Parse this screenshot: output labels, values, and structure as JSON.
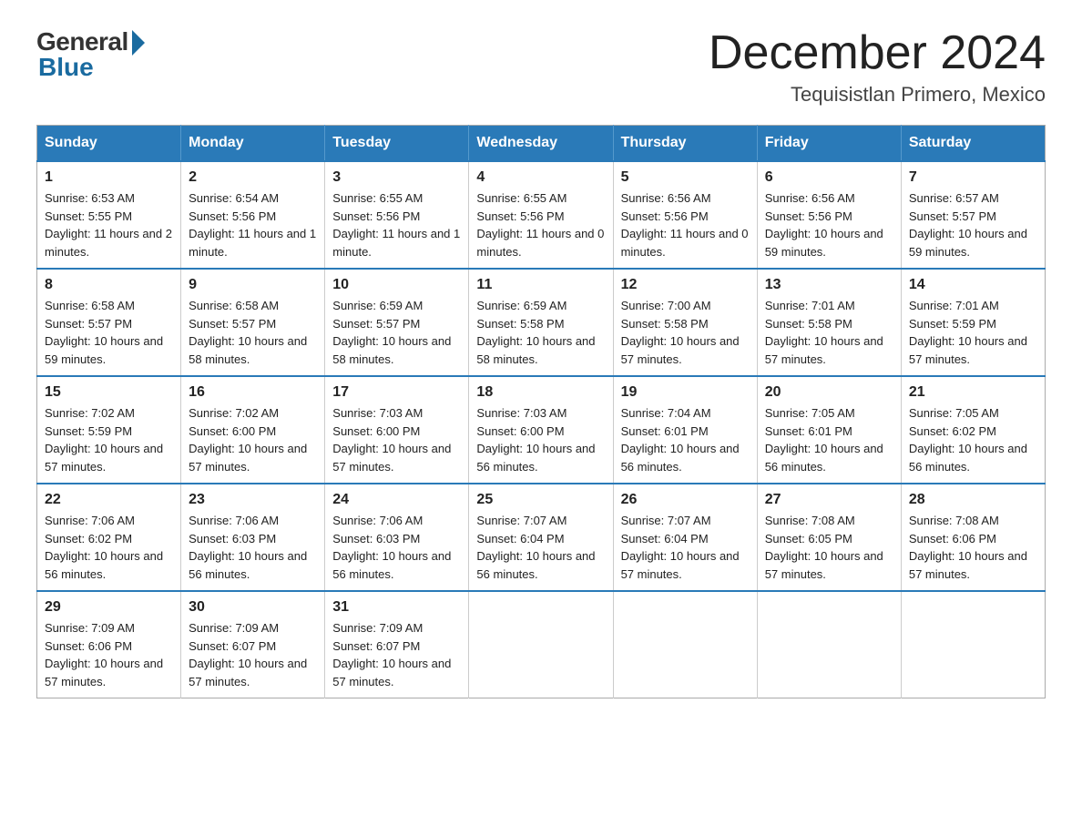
{
  "header": {
    "logo_general": "General",
    "logo_blue": "Blue",
    "month_title": "December 2024",
    "location": "Tequisistlan Primero, Mexico"
  },
  "days_of_week": [
    "Sunday",
    "Monday",
    "Tuesday",
    "Wednesday",
    "Thursday",
    "Friday",
    "Saturday"
  ],
  "weeks": [
    [
      {
        "day": "1",
        "sunrise": "6:53 AM",
        "sunset": "5:55 PM",
        "daylight": "11 hours and 2 minutes."
      },
      {
        "day": "2",
        "sunrise": "6:54 AM",
        "sunset": "5:56 PM",
        "daylight": "11 hours and 1 minute."
      },
      {
        "day": "3",
        "sunrise": "6:55 AM",
        "sunset": "5:56 PM",
        "daylight": "11 hours and 1 minute."
      },
      {
        "day": "4",
        "sunrise": "6:55 AM",
        "sunset": "5:56 PM",
        "daylight": "11 hours and 0 minutes."
      },
      {
        "day": "5",
        "sunrise": "6:56 AM",
        "sunset": "5:56 PM",
        "daylight": "11 hours and 0 minutes."
      },
      {
        "day": "6",
        "sunrise": "6:56 AM",
        "sunset": "5:56 PM",
        "daylight": "10 hours and 59 minutes."
      },
      {
        "day": "7",
        "sunrise": "6:57 AM",
        "sunset": "5:57 PM",
        "daylight": "10 hours and 59 minutes."
      }
    ],
    [
      {
        "day": "8",
        "sunrise": "6:58 AM",
        "sunset": "5:57 PM",
        "daylight": "10 hours and 59 minutes."
      },
      {
        "day": "9",
        "sunrise": "6:58 AM",
        "sunset": "5:57 PM",
        "daylight": "10 hours and 58 minutes."
      },
      {
        "day": "10",
        "sunrise": "6:59 AM",
        "sunset": "5:57 PM",
        "daylight": "10 hours and 58 minutes."
      },
      {
        "day": "11",
        "sunrise": "6:59 AM",
        "sunset": "5:58 PM",
        "daylight": "10 hours and 58 minutes."
      },
      {
        "day": "12",
        "sunrise": "7:00 AM",
        "sunset": "5:58 PM",
        "daylight": "10 hours and 57 minutes."
      },
      {
        "day": "13",
        "sunrise": "7:01 AM",
        "sunset": "5:58 PM",
        "daylight": "10 hours and 57 minutes."
      },
      {
        "day": "14",
        "sunrise": "7:01 AM",
        "sunset": "5:59 PM",
        "daylight": "10 hours and 57 minutes."
      }
    ],
    [
      {
        "day": "15",
        "sunrise": "7:02 AM",
        "sunset": "5:59 PM",
        "daylight": "10 hours and 57 minutes."
      },
      {
        "day": "16",
        "sunrise": "7:02 AM",
        "sunset": "6:00 PM",
        "daylight": "10 hours and 57 minutes."
      },
      {
        "day": "17",
        "sunrise": "7:03 AM",
        "sunset": "6:00 PM",
        "daylight": "10 hours and 57 minutes."
      },
      {
        "day": "18",
        "sunrise": "7:03 AM",
        "sunset": "6:00 PM",
        "daylight": "10 hours and 56 minutes."
      },
      {
        "day": "19",
        "sunrise": "7:04 AM",
        "sunset": "6:01 PM",
        "daylight": "10 hours and 56 minutes."
      },
      {
        "day": "20",
        "sunrise": "7:05 AM",
        "sunset": "6:01 PM",
        "daylight": "10 hours and 56 minutes."
      },
      {
        "day": "21",
        "sunrise": "7:05 AM",
        "sunset": "6:02 PM",
        "daylight": "10 hours and 56 minutes."
      }
    ],
    [
      {
        "day": "22",
        "sunrise": "7:06 AM",
        "sunset": "6:02 PM",
        "daylight": "10 hours and 56 minutes."
      },
      {
        "day": "23",
        "sunrise": "7:06 AM",
        "sunset": "6:03 PM",
        "daylight": "10 hours and 56 minutes."
      },
      {
        "day": "24",
        "sunrise": "7:06 AM",
        "sunset": "6:03 PM",
        "daylight": "10 hours and 56 minutes."
      },
      {
        "day": "25",
        "sunrise": "7:07 AM",
        "sunset": "6:04 PM",
        "daylight": "10 hours and 56 minutes."
      },
      {
        "day": "26",
        "sunrise": "7:07 AM",
        "sunset": "6:04 PM",
        "daylight": "10 hours and 57 minutes."
      },
      {
        "day": "27",
        "sunrise": "7:08 AM",
        "sunset": "6:05 PM",
        "daylight": "10 hours and 57 minutes."
      },
      {
        "day": "28",
        "sunrise": "7:08 AM",
        "sunset": "6:06 PM",
        "daylight": "10 hours and 57 minutes."
      }
    ],
    [
      {
        "day": "29",
        "sunrise": "7:09 AM",
        "sunset": "6:06 PM",
        "daylight": "10 hours and 57 minutes."
      },
      {
        "day": "30",
        "sunrise": "7:09 AM",
        "sunset": "6:07 PM",
        "daylight": "10 hours and 57 minutes."
      },
      {
        "day": "31",
        "sunrise": "7:09 AM",
        "sunset": "6:07 PM",
        "daylight": "10 hours and 57 minutes."
      },
      null,
      null,
      null,
      null
    ]
  ]
}
